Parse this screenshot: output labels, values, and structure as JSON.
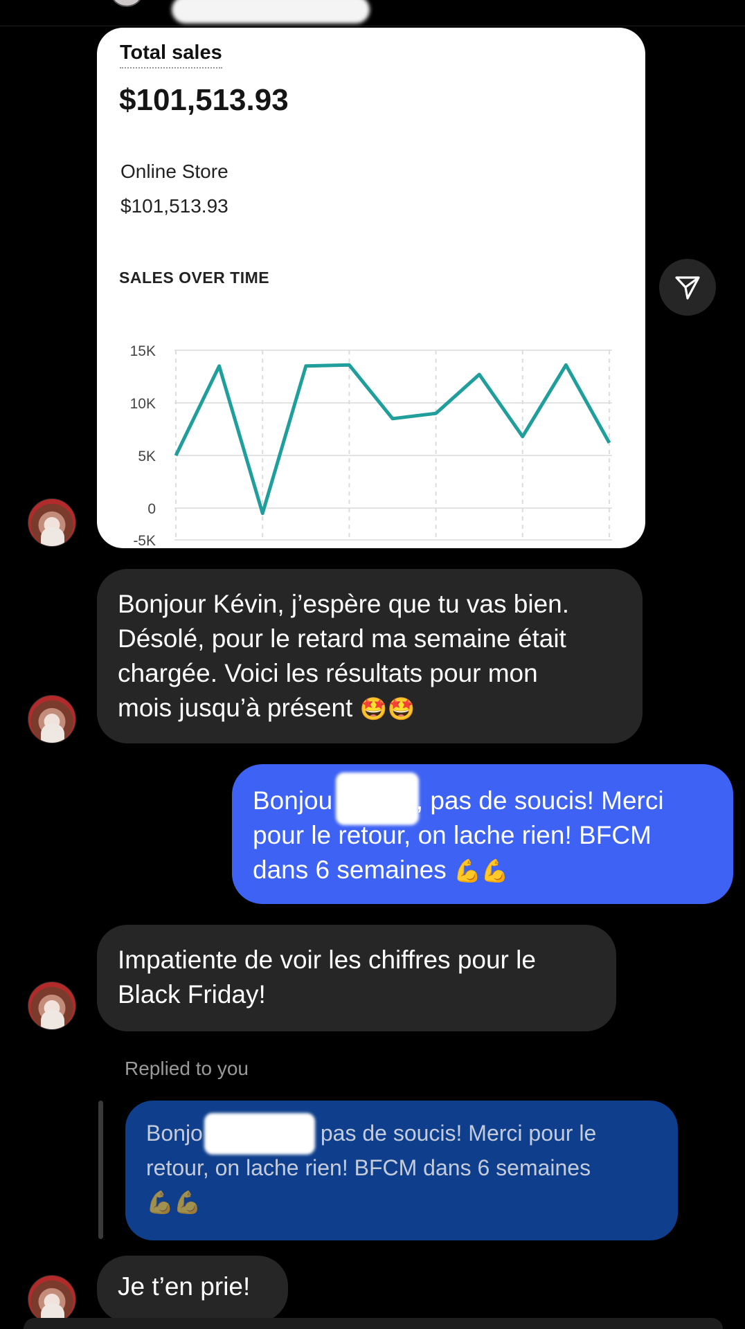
{
  "chart_data": {
    "type": "line",
    "title": "SALES OVER TIME",
    "yticks": [
      "15K",
      "10K",
      "5K",
      "0",
      "-5K"
    ],
    "ylim": [
      -5000,
      15000
    ],
    "x": [
      1,
      2,
      3,
      4,
      5,
      6,
      7,
      8,
      9,
      10,
      11
    ],
    "values": [
      5000,
      13500,
      -500,
      13500,
      13600,
      8500,
      9000,
      12700,
      6800,
      13600,
      6200
    ],
    "series_color": "#1f9e9c",
    "grid": true
  },
  "card": {
    "title": "Total sales",
    "total": "$101,513.93",
    "store_label": "Online Store",
    "store_value": "$101,513.93"
  },
  "messages": {
    "m1_lines": [
      "Bonjour Kévin, j’espère que tu vas bien.",
      "Désolé, pour le retard ma semaine était",
      "chargée. Voici les résultats pour mon",
      "mois jusqu’à présent"
    ],
    "m1_emoji": "🤩🤩",
    "m2_lines": [
      "Bonjou",
      "e, pas de soucis! Merci",
      "pour le retour, on lache rien! BFCM",
      "dans 6 semaines"
    ],
    "m2_emoji": "💪💪",
    "m3_lines": [
      "Impatiente de voir les chiffres pour le",
      "Black Friday!"
    ],
    "replied_label": "Replied to you",
    "reply_lines": [
      "Bonjo",
      "pas de soucis! Merci pour le",
      "retour, on lache rien! BFCM dans 6 semaines"
    ],
    "reply_emoji": "💪💪",
    "m4": "Je t’en prie!"
  },
  "colors": {
    "sent_bubble": "#3e63f4",
    "received_bubble": "#262626",
    "reply_bubble": "#0f3f8c",
    "chart_line": "#1f9e9c"
  },
  "icons": {
    "share": "paper-plane-icon"
  }
}
